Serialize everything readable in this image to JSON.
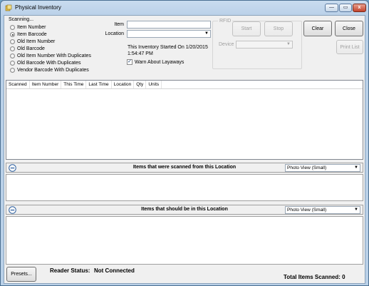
{
  "window": {
    "title": "Physical Inventory",
    "controls": {
      "minimize": "—",
      "maximize": "▭",
      "close": "x"
    }
  },
  "scanning": {
    "label": "Scanning...",
    "options": [
      {
        "label": "Item Number",
        "selected": false
      },
      {
        "label": "Item Barcode",
        "selected": true
      },
      {
        "label": "Old Item Number",
        "selected": false
      },
      {
        "label": "Old Barcode",
        "selected": false
      },
      {
        "label": "Old Item Number With Duplicates",
        "selected": false
      },
      {
        "label": "Old Barcode With Duplicates",
        "selected": false
      },
      {
        "label": "Vendor Barcode With Duplicates",
        "selected": false
      }
    ]
  },
  "item": {
    "label": "Item",
    "value": ""
  },
  "location": {
    "label": "Location",
    "value": ""
  },
  "inventory_started": {
    "line1": "This Inventory Started On 1/20/2015",
    "line2": "1:54:47 PM"
  },
  "warn_layaways": {
    "label": "Warn About Layaways",
    "checked": true,
    "mark": "✓"
  },
  "rfid": {
    "label": "RFID",
    "start_label": "Start",
    "stop_label": "Stop",
    "device_label": "Device",
    "device_value": ""
  },
  "buttons": {
    "clear": "Clear",
    "close": "Close",
    "print_list": "Print List",
    "presets": "Presets..."
  },
  "list": {
    "columns": [
      "Scanned",
      "Item Number",
      "This Time",
      "Last Time",
      "Location",
      "Qty",
      "Units"
    ],
    "rows": []
  },
  "scanned_section": {
    "title": "Items that were scanned from this Location",
    "view": "Photo View (Small)"
  },
  "expected_section": {
    "title": "Items that should be in this Location",
    "view": "Photo View (Small)"
  },
  "status": {
    "reader_label": "Reader Status:",
    "reader_value": "Not Connected",
    "total_label": "Total Items Scanned: 0"
  },
  "icons": {
    "dropdown": "▼",
    "collapse": "collapse-minus-icon",
    "app": "app-icon"
  }
}
